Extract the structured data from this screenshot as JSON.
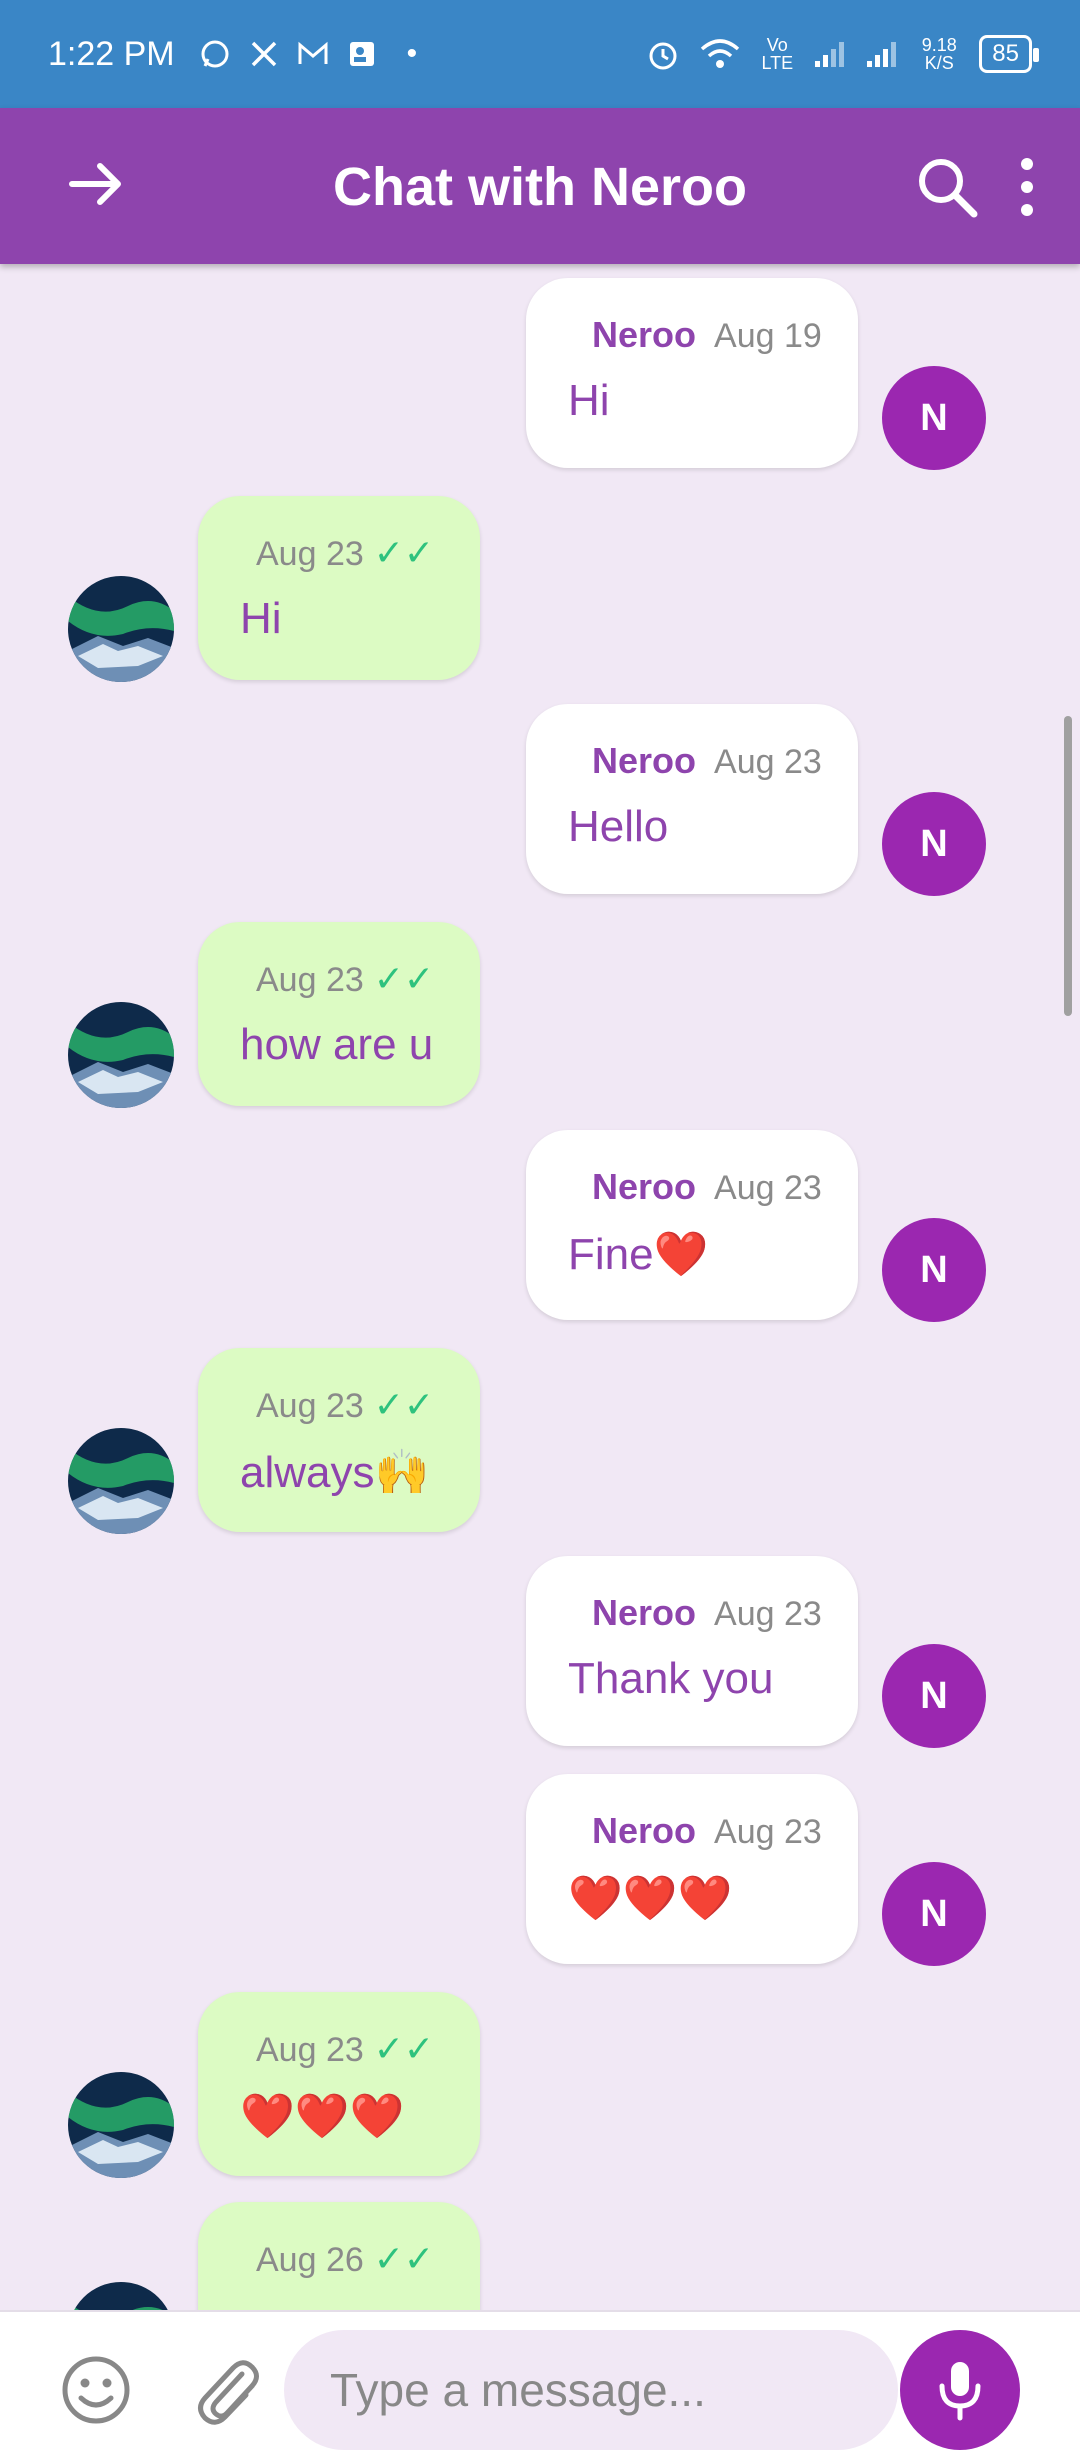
{
  "status_bar": {
    "time": "1:22 PM",
    "left_icons": [
      "whatsapp-icon",
      "x-icon",
      "mail-icon",
      "contact-icon",
      "dot-icon"
    ],
    "net_speed": "9.18 K/S",
    "volte": "Vo LTE",
    "battery": "85"
  },
  "appbar": {
    "title": "Chat with Neroo",
    "back_icon": "arrow-right-icon",
    "search_icon": "search-icon",
    "more_icon": "more-vert-icon"
  },
  "messages": [
    {
      "dir": "out",
      "sender": "Neroo",
      "date": "Aug 19",
      "text": "Hi",
      "avatar": "N"
    },
    {
      "dir": "in",
      "date": "Aug 23",
      "checks": "✓✓",
      "text": "Hi"
    },
    {
      "dir": "out",
      "sender": "Neroo",
      "date": "Aug 23",
      "text": "Hello",
      "avatar": "N"
    },
    {
      "dir": "in",
      "date": "Aug 23",
      "checks": "✓✓",
      "text": "how are u"
    },
    {
      "dir": "out",
      "sender": "Neroo",
      "date": "Aug 23",
      "text": "Fine❤️",
      "avatar": "N"
    },
    {
      "dir": "in",
      "date": "Aug 23",
      "checks": "✓✓",
      "text": "always🙌"
    },
    {
      "dir": "out",
      "sender": "Neroo",
      "date": "Aug 23",
      "text": "Thank you",
      "avatar": "N"
    },
    {
      "dir": "out",
      "sender": "Neroo",
      "date": "Aug 23",
      "text": "❤️❤️❤️",
      "avatar": "N"
    },
    {
      "dir": "in",
      "date": "Aug 23",
      "checks": "✓✓",
      "text": "❤️❤️❤️"
    },
    {
      "dir": "in",
      "date": "Aug 26",
      "checks": "✓✓",
      "text": ""
    }
  ],
  "composer": {
    "placeholder": "Type a message...",
    "emoji_icon": "emoji-icon",
    "attach_icon": "paperclip-icon",
    "mic_icon": "mic-icon"
  },
  "colors": {
    "status_bar": "#3A86C6",
    "appbar": "#8E44AD",
    "background": "#F1E8F5",
    "incoming_bubble": "#DCFBC3",
    "outgoing_bubble": "#FFFFFF",
    "avatar": "#9B27B0",
    "checks": "#2EC27E"
  }
}
